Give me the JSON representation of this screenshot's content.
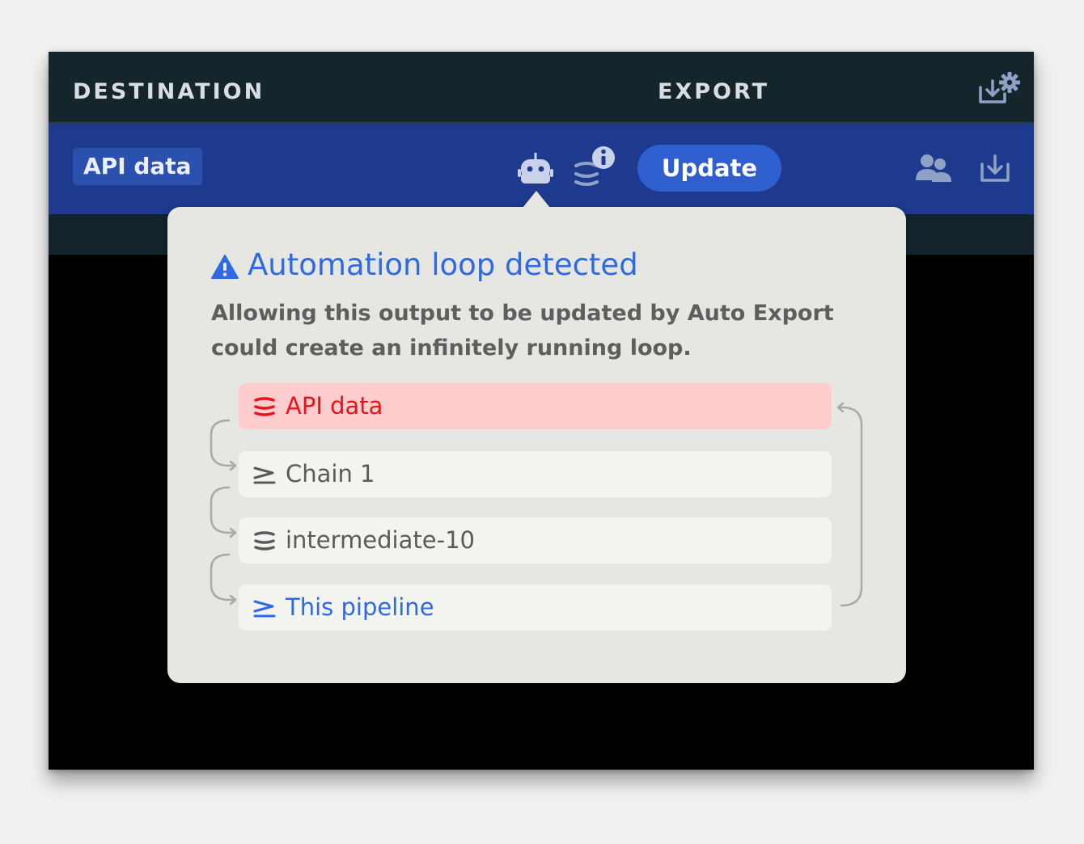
{
  "header": {
    "destination_label": "DESTINATION",
    "export_label": "EXPORT"
  },
  "toolbar": {
    "dataset_tag": "API data",
    "update_label": "Update"
  },
  "popover": {
    "title": "Automation loop detected",
    "description": "Allowing this output to be updated by Auto Export could create an infinitely running loop.",
    "loop_items": [
      {
        "label": "API data",
        "icon": "dataset-icon",
        "state": "error"
      },
      {
        "label": "Chain 1",
        "icon": "pipeline-icon",
        "state": "normal"
      },
      {
        "label": "intermediate-10",
        "icon": "dataset-icon",
        "state": "normal"
      },
      {
        "label": "This pipeline",
        "icon": "pipeline-icon",
        "state": "current"
      }
    ]
  },
  "colors": {
    "accent_blue": "#2f6ae0",
    "error_red": "#e8141b",
    "error_bg": "#ffcdcd",
    "toolbar_blue": "#1e3a8f",
    "header_dark": "#14252c"
  }
}
